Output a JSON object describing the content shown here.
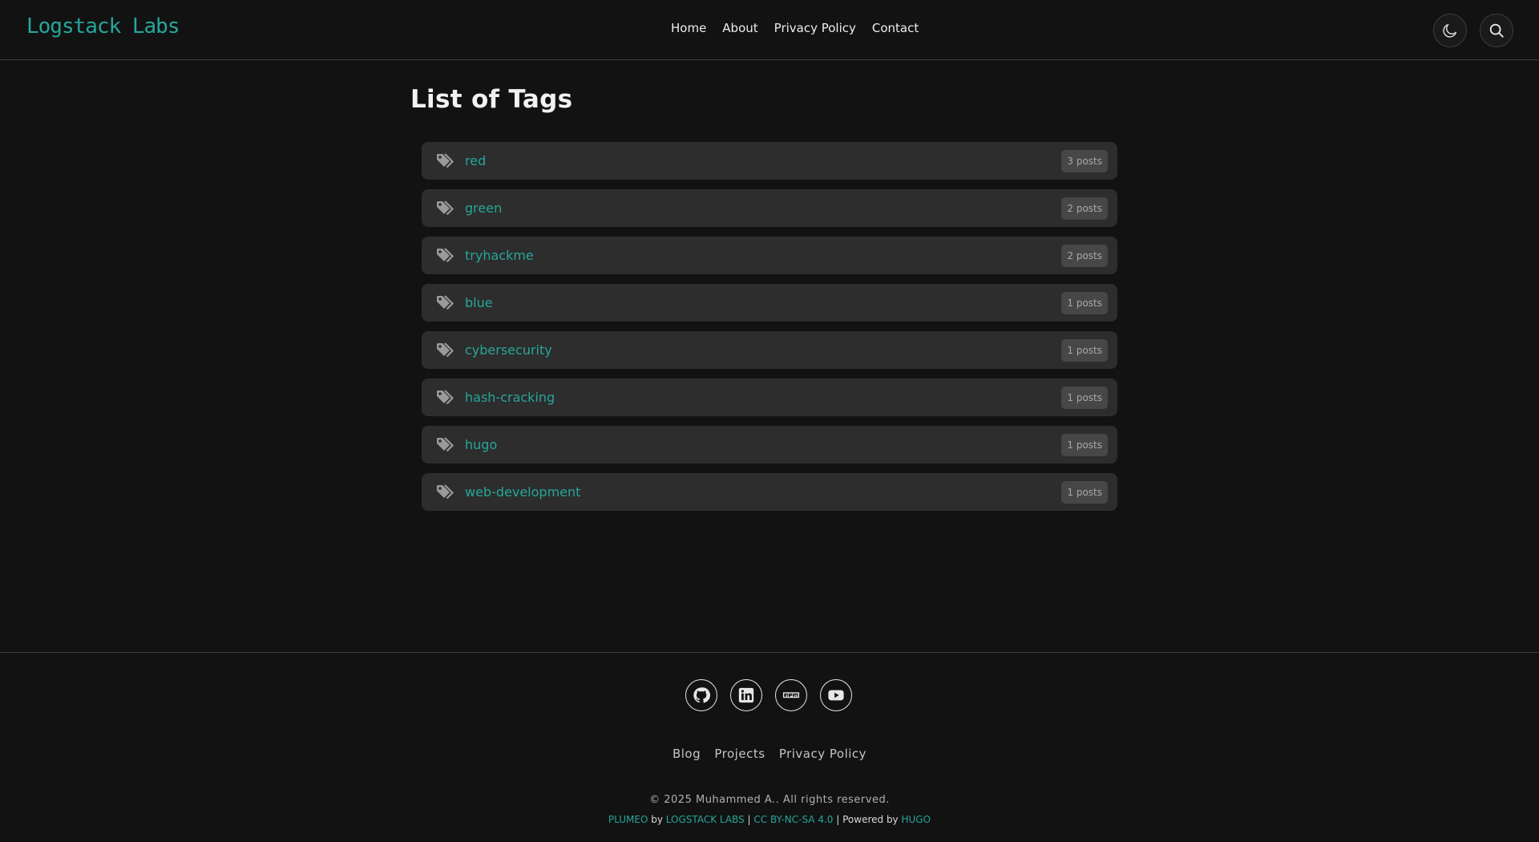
{
  "header": {
    "brand": "Logstack Labs",
    "nav": [
      "Home",
      "About",
      "Privacy Policy",
      "Contact"
    ],
    "icons": {
      "theme": "moon-icon",
      "search": "search-icon"
    }
  },
  "main": {
    "title": "List of Tags",
    "tags": [
      {
        "name": "red",
        "count": "3 posts"
      },
      {
        "name": "green",
        "count": "2 posts"
      },
      {
        "name": "tryhackme",
        "count": "2 posts"
      },
      {
        "name": "blue",
        "count": "1 posts"
      },
      {
        "name": "cybersecurity",
        "count": "1 posts"
      },
      {
        "name": "hash-cracking",
        "count": "1 posts"
      },
      {
        "name": "hugo",
        "count": "1 posts"
      },
      {
        "name": "web-development",
        "count": "1 posts"
      }
    ]
  },
  "footer": {
    "socials": [
      "github-icon",
      "linkedin-icon",
      "npm-icon",
      "youtube-icon"
    ],
    "links": [
      "Blog",
      "Projects",
      "Privacy Policy"
    ],
    "copyright": "© 2025 Muhammed A.. All rights reserved.",
    "credits": {
      "theme": "PLUMEO",
      "by": "by",
      "org": "LOGSTACK LABS",
      "sep1": "|",
      "license": "CC BY-NC-SA 4.0",
      "powered": "| Powered by",
      "engine": "HUGO"
    }
  },
  "colors": {
    "accent": "#26a69a",
    "background": "#121212",
    "card": "#2d2d2d",
    "badge": "#474747"
  }
}
